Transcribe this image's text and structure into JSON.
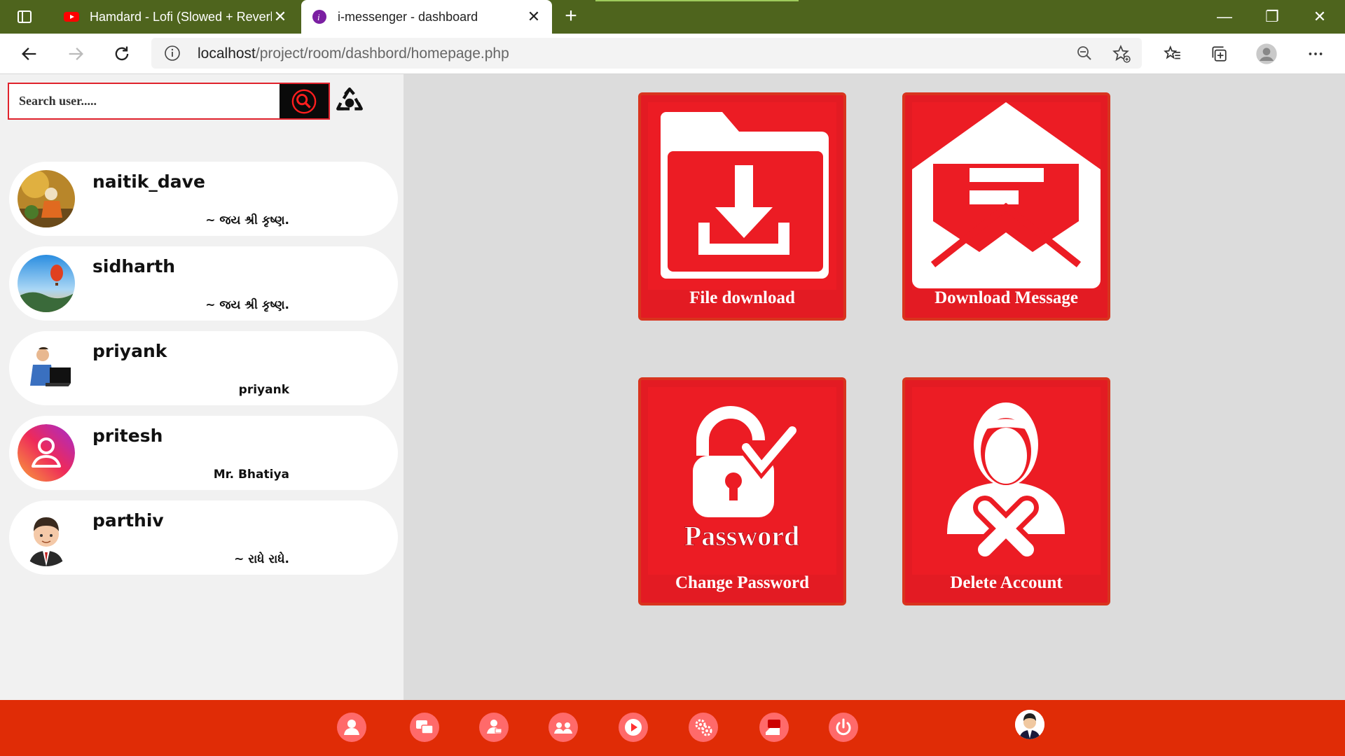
{
  "browser": {
    "tabs": [
      {
        "title": "Hamdard - Lofi (Slowed + Reverb",
        "favicon": "youtube-icon",
        "active": false
      },
      {
        "title": "i-messenger - dashboard",
        "favicon": "messenger-icon",
        "active": true
      }
    ],
    "url_host": "localhost",
    "url_path": "/project/room/dashbord/homepage.php"
  },
  "sidebar": {
    "search_placeholder": "Search user.....",
    "users": [
      {
        "name": "naitik_dave",
        "status": "~ જય શ્રી કૃષ્ણ."
      },
      {
        "name": "sidharth",
        "status": "~ જય શ્રી કૃષ્ણ."
      },
      {
        "name": "priyank",
        "status": "priyank"
      },
      {
        "name": "pritesh",
        "status": "Mr. Bhatiya"
      },
      {
        "name": "parthiv",
        "status": "~ રાધે રાધે."
      }
    ]
  },
  "cards": {
    "file_download": "File download",
    "download_message": "Download Message",
    "change_password": "Change Password",
    "password_art_text": "Password",
    "delete_account": "Delete Account"
  },
  "colors": {
    "accent": "#e31b23",
    "bottombar": "#e02c06",
    "tabbar": "#4e641d"
  }
}
